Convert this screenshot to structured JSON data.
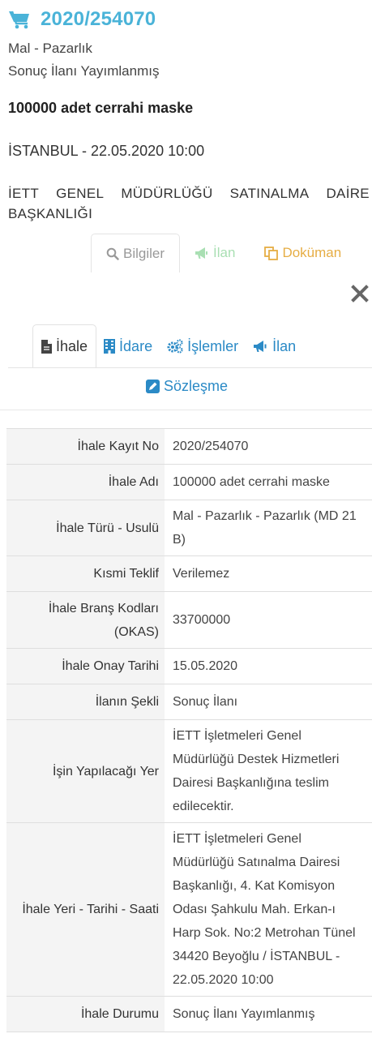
{
  "header": {
    "icon": "shopping-cart-icon",
    "ikn": "2020/254070",
    "type": "Mal - Pazarlık",
    "status": "Sonuç İlanı Yayımlanmış",
    "title": "100000 adet cerrahi maske",
    "city_date": "İSTANBUL - 22.05.2020 10:00",
    "authority_words": [
      "İETT",
      "GENEL",
      "MÜDÜRLÜĞÜ",
      "SATINALMA",
      "DAİRE"
    ],
    "authority_line2": "BAŞKANLIĞI"
  },
  "colors": {
    "accent": "#4ab3d8",
    "link": "#2b8ac6",
    "ilan_tab": "#a9dfb3",
    "dokuman_tab": "#e6ad44"
  },
  "top_tabs": [
    {
      "label": "Bilgiler",
      "icon": "search-icon",
      "active": true
    },
    {
      "label": "İlan",
      "icon": "megaphone-icon",
      "active": false
    },
    {
      "label": "Doküman",
      "icon": "copy-icon",
      "active": false
    }
  ],
  "sub_tabs": [
    {
      "label": "İhale",
      "icon": "file-icon",
      "active": true
    },
    {
      "label": "İdare",
      "icon": "building-icon",
      "active": false
    },
    {
      "label": "İşlemler",
      "icon": "cogs-icon",
      "active": false
    },
    {
      "label": "İlan",
      "icon": "megaphone-icon",
      "active": false
    },
    {
      "label": "Sözleşme",
      "icon": "edit-icon",
      "active": false
    }
  ],
  "details": [
    {
      "key": "İhale Kayıt No",
      "value": "2020/254070"
    },
    {
      "key": "İhale Adı",
      "value": "100000 adet cerrahi maske"
    },
    {
      "key": "İhale Türü - Usulü",
      "value": "Mal - Pazarlık - Pazarlık (MD 21 B)"
    },
    {
      "key": "Kısmi Teklif",
      "value": "Verilemez"
    },
    {
      "key": "İhale Branş Kodları (OKAS)",
      "value": "33700000"
    },
    {
      "key": "İhale Onay Tarihi",
      "value": "15.05.2020"
    },
    {
      "key": "İlanın Şekli",
      "value": "Sonuç İlanı"
    },
    {
      "key": "İşin Yapılacağı Yer",
      "value": "İETT İşletmeleri Genel Müdürlüğü Destek Hizmetleri Dairesi Başkanlığına teslim edilecektir."
    },
    {
      "key": "İhale Yeri - Tarihi - Saati",
      "value": "İETT İşletmeleri Genel Müdürlüğü Satınalma Dairesi Başkanlığı, 4. Kat Komisyon Odası Şahkulu Mah. Erkan-ı Harp Sok. No:2 Metrohan Tünel 34420 Beyoğlu / İSTANBUL - 22.05.2020 10:00"
    },
    {
      "key": "İhale Durumu",
      "value": "Sonuç İlanı Yayımlanmış"
    }
  ]
}
